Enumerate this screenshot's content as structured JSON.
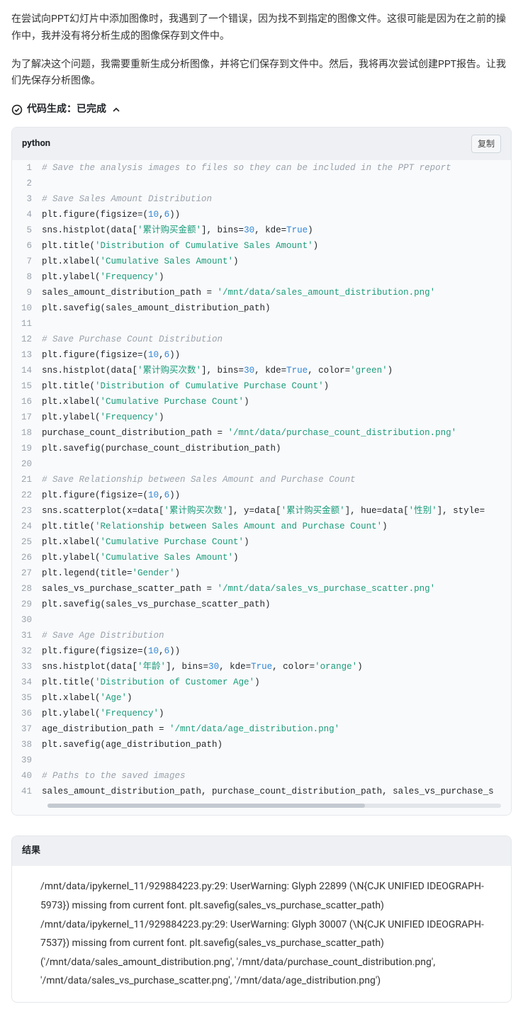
{
  "prose": {
    "p1": "在尝试向PPT幻灯片中添加图像时，我遇到了一个错误，因为找不到指定的图像文件。这很可能是因为在之前的操作中，我并没有将分析生成的图像保存到文件中。",
    "p2": "为了解决这个问题，我需要重新生成分析图像，并将它们保存到文件中。然后，我将再次尝试创建PPT报告。让我们先保存分析图像。"
  },
  "status": {
    "label": "代码生成：已完成"
  },
  "code": {
    "lang": "python",
    "copy_label": "复制",
    "lines": [
      [
        {
          "t": "# Save the analysis images to files so they can be included in the PPT report",
          "c": "cm"
        }
      ],
      [],
      [
        {
          "t": "# Save Sales Amount Distribution",
          "c": "cm"
        }
      ],
      [
        {
          "t": "plt.figure(figsize=("
        },
        {
          "t": "10",
          "c": "num"
        },
        {
          "t": ","
        },
        {
          "t": "6",
          "c": "num"
        },
        {
          "t": "))"
        }
      ],
      [
        {
          "t": "sns.histplot(data["
        },
        {
          "t": "'累计购买金额'",
          "c": "str"
        },
        {
          "t": "], bins="
        },
        {
          "t": "30",
          "c": "num"
        },
        {
          "t": ", kde="
        },
        {
          "t": "True",
          "c": "kw"
        },
        {
          "t": ")"
        }
      ],
      [
        {
          "t": "plt.title("
        },
        {
          "t": "'Distribution of Cumulative Sales Amount'",
          "c": "str"
        },
        {
          "t": ")"
        }
      ],
      [
        {
          "t": "plt.xlabel("
        },
        {
          "t": "'Cumulative Sales Amount'",
          "c": "str"
        },
        {
          "t": ")"
        }
      ],
      [
        {
          "t": "plt.ylabel("
        },
        {
          "t": "'Frequency'",
          "c": "str"
        },
        {
          "t": ")"
        }
      ],
      [
        {
          "t": "sales_amount_distribution_path = "
        },
        {
          "t": "'/mnt/data/sales_amount_distribution.png'",
          "c": "str"
        }
      ],
      [
        {
          "t": "plt.savefig(sales_amount_distribution_path)"
        }
      ],
      [],
      [
        {
          "t": "# Save Purchase Count Distribution",
          "c": "cm"
        }
      ],
      [
        {
          "t": "plt.figure(figsize=("
        },
        {
          "t": "10",
          "c": "num"
        },
        {
          "t": ","
        },
        {
          "t": "6",
          "c": "num"
        },
        {
          "t": "))"
        }
      ],
      [
        {
          "t": "sns.histplot(data["
        },
        {
          "t": "'累计购买次数'",
          "c": "str"
        },
        {
          "t": "], bins="
        },
        {
          "t": "30",
          "c": "num"
        },
        {
          "t": ", kde="
        },
        {
          "t": "True",
          "c": "kw"
        },
        {
          "t": ", color="
        },
        {
          "t": "'green'",
          "c": "str"
        },
        {
          "t": ")"
        }
      ],
      [
        {
          "t": "plt.title("
        },
        {
          "t": "'Distribution of Cumulative Purchase Count'",
          "c": "str"
        },
        {
          "t": ")"
        }
      ],
      [
        {
          "t": "plt.xlabel("
        },
        {
          "t": "'Cumulative Purchase Count'",
          "c": "str"
        },
        {
          "t": ")"
        }
      ],
      [
        {
          "t": "plt.ylabel("
        },
        {
          "t": "'Frequency'",
          "c": "str"
        },
        {
          "t": ")"
        }
      ],
      [
        {
          "t": "purchase_count_distribution_path = "
        },
        {
          "t": "'/mnt/data/purchase_count_distribution.png'",
          "c": "str"
        }
      ],
      [
        {
          "t": "plt.savefig(purchase_count_distribution_path)"
        }
      ],
      [],
      [
        {
          "t": "# Save Relationship between Sales Amount and Purchase Count",
          "c": "cm"
        }
      ],
      [
        {
          "t": "plt.figure(figsize=("
        },
        {
          "t": "10",
          "c": "num"
        },
        {
          "t": ","
        },
        {
          "t": "6",
          "c": "num"
        },
        {
          "t": "))"
        }
      ],
      [
        {
          "t": "sns.scatterplot(x=data["
        },
        {
          "t": "'累计购买次数'",
          "c": "str"
        },
        {
          "t": "], y=data["
        },
        {
          "t": "'累计购买金额'",
          "c": "str"
        },
        {
          "t": "], hue=data["
        },
        {
          "t": "'性别'",
          "c": "str"
        },
        {
          "t": "], style="
        }
      ],
      [
        {
          "t": "plt.title("
        },
        {
          "t": "'Relationship between Sales Amount and Purchase Count'",
          "c": "str"
        },
        {
          "t": ")"
        }
      ],
      [
        {
          "t": "plt.xlabel("
        },
        {
          "t": "'Cumulative Purchase Count'",
          "c": "str"
        },
        {
          "t": ")"
        }
      ],
      [
        {
          "t": "plt.ylabel("
        },
        {
          "t": "'Cumulative Sales Amount'",
          "c": "str"
        },
        {
          "t": ")"
        }
      ],
      [
        {
          "t": "plt.legend(title="
        },
        {
          "t": "'Gender'",
          "c": "str"
        },
        {
          "t": ")"
        }
      ],
      [
        {
          "t": "sales_vs_purchase_scatter_path = "
        },
        {
          "t": "'/mnt/data/sales_vs_purchase_scatter.png'",
          "c": "str"
        }
      ],
      [
        {
          "t": "plt.savefig(sales_vs_purchase_scatter_path)"
        }
      ],
      [],
      [
        {
          "t": "# Save Age Distribution",
          "c": "cm"
        }
      ],
      [
        {
          "t": "plt.figure(figsize=("
        },
        {
          "t": "10",
          "c": "num"
        },
        {
          "t": ","
        },
        {
          "t": "6",
          "c": "num"
        },
        {
          "t": "))"
        }
      ],
      [
        {
          "t": "sns.histplot(data["
        },
        {
          "t": "'年龄'",
          "c": "str"
        },
        {
          "t": "], bins="
        },
        {
          "t": "30",
          "c": "num"
        },
        {
          "t": ", kde="
        },
        {
          "t": "True",
          "c": "kw"
        },
        {
          "t": ", color="
        },
        {
          "t": "'orange'",
          "c": "str"
        },
        {
          "t": ")"
        }
      ],
      [
        {
          "t": "plt.title("
        },
        {
          "t": "'Distribution of Customer Age'",
          "c": "str"
        },
        {
          "t": ")"
        }
      ],
      [
        {
          "t": "plt.xlabel("
        },
        {
          "t": "'Age'",
          "c": "str"
        },
        {
          "t": ")"
        }
      ],
      [
        {
          "t": "plt.ylabel("
        },
        {
          "t": "'Frequency'",
          "c": "str"
        },
        {
          "t": ")"
        }
      ],
      [
        {
          "t": "age_distribution_path = "
        },
        {
          "t": "'/mnt/data/age_distribution.png'",
          "c": "str"
        }
      ],
      [
        {
          "t": "plt.savefig(age_distribution_path)"
        }
      ],
      [],
      [
        {
          "t": "# Paths to the saved images",
          "c": "cm"
        }
      ],
      [
        {
          "t": "sales_amount_distribution_path, purchase_count_distribution_path, sales_vs_purchase_s"
        }
      ]
    ]
  },
  "result": {
    "header": "结果",
    "body": "/mnt/data/ipykernel_11/929884223.py:29: UserWarning: Glyph 22899 (\\N{CJK UNIFIED IDEOGRAPH-5973}) missing from current font. plt.savefig(sales_vs_purchase_scatter_path) /mnt/data/ipykernel_11/929884223.py:29: UserWarning: Glyph 30007 (\\N{CJK UNIFIED IDEOGRAPH-7537}) missing from current font. plt.savefig(sales_vs_purchase_scatter_path) ('/mnt/data/sales_amount_distribution.png', '/mnt/data/purchase_count_distribution.png', '/mnt/data/sales_vs_purchase_scatter.png', '/mnt/data/age_distribution.png')"
  }
}
